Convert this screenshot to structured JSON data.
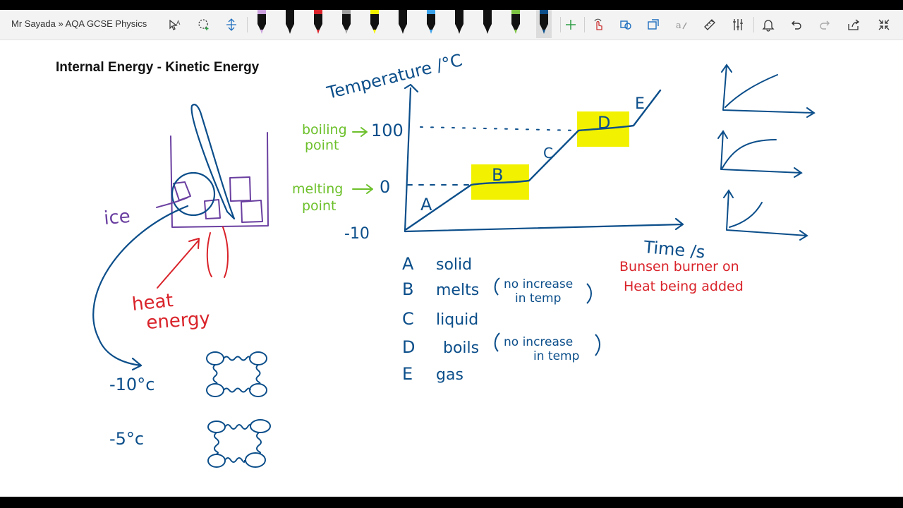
{
  "window": {
    "breadcrumb": "Mr Sayada » AQA GCSE Physics"
  },
  "toolbar": {
    "tools": [
      {
        "name": "text-select-icon"
      },
      {
        "name": "lasso-select-icon"
      },
      {
        "name": "add-space-icon"
      }
    ],
    "pens": [
      {
        "name": "pen-lavender",
        "color": "#c9a0dc"
      },
      {
        "name": "pen-black-1",
        "color": "#111111"
      },
      {
        "name": "pen-red",
        "color": "#d9232a"
      },
      {
        "name": "pen-grey",
        "color": "#9e9e9e"
      },
      {
        "name": "pen-yellow",
        "color": "#f2f200"
      },
      {
        "name": "pen-black-2",
        "color": "#111111"
      },
      {
        "name": "pen-rainbow",
        "color": "#3aa0e8"
      },
      {
        "name": "pen-black-3",
        "color": "#111111"
      },
      {
        "name": "pen-black-4",
        "color": "#111111"
      },
      {
        "name": "pen-green",
        "color": "#7cc242"
      },
      {
        "name": "pen-blue-active",
        "color": "#0b4e8a"
      }
    ],
    "right_icons": [
      "add-pen-icon",
      "touch-drawing-icon",
      "ink-to-shape-icon",
      "ink-to-text-icon",
      "ink-to-math-icon",
      "ruler-icon",
      "settings-sliders-icon",
      "notification-bell-icon",
      "undo-icon",
      "redo-icon",
      "share-icon",
      "collapse-icon"
    ]
  },
  "page": {
    "title": "Internal Energy - Kinetic Energy"
  },
  "ink_colors": {
    "blue": "#0b4e8a",
    "purple": "#6a3fa0",
    "green": "#6cc02a",
    "red": "#d9232a",
    "highlight": "#f2f200"
  },
  "notes": {
    "ice_label": "ice",
    "heat_label_1": "heat",
    "heat_label_2": "energy",
    "temp_minus10": "-10°c",
    "temp_minus5": "-5°c"
  },
  "graph": {
    "y_axis_label": "Temperature /°C",
    "x_axis_label": "Time /s",
    "tick_100": "100",
    "tick_0": "0",
    "tick_minus10": "-10",
    "boiling_point_1": "boiling",
    "boiling_point_2": "point",
    "melting_point_1": "melting",
    "melting_point_2": "point",
    "segment_A": "A",
    "segment_B": "B",
    "segment_C": "C",
    "segment_D": "D",
    "segment_E": "E",
    "note_1": "Bunsen burner on",
    "note_2": "Heat being added"
  },
  "key": [
    {
      "letter": "A",
      "text": "solid",
      "note1": "",
      "note2": ""
    },
    {
      "letter": "B",
      "text": "melts",
      "note1": "no increase",
      "note2": "in temp"
    },
    {
      "letter": "C",
      "text": "liquid",
      "note1": "",
      "note2": ""
    },
    {
      "letter": "D",
      "text": "boils",
      "note1": "no increase",
      "note2": "in temp"
    },
    {
      "letter": "E",
      "text": "gas",
      "note1": "",
      "note2": ""
    }
  ]
}
